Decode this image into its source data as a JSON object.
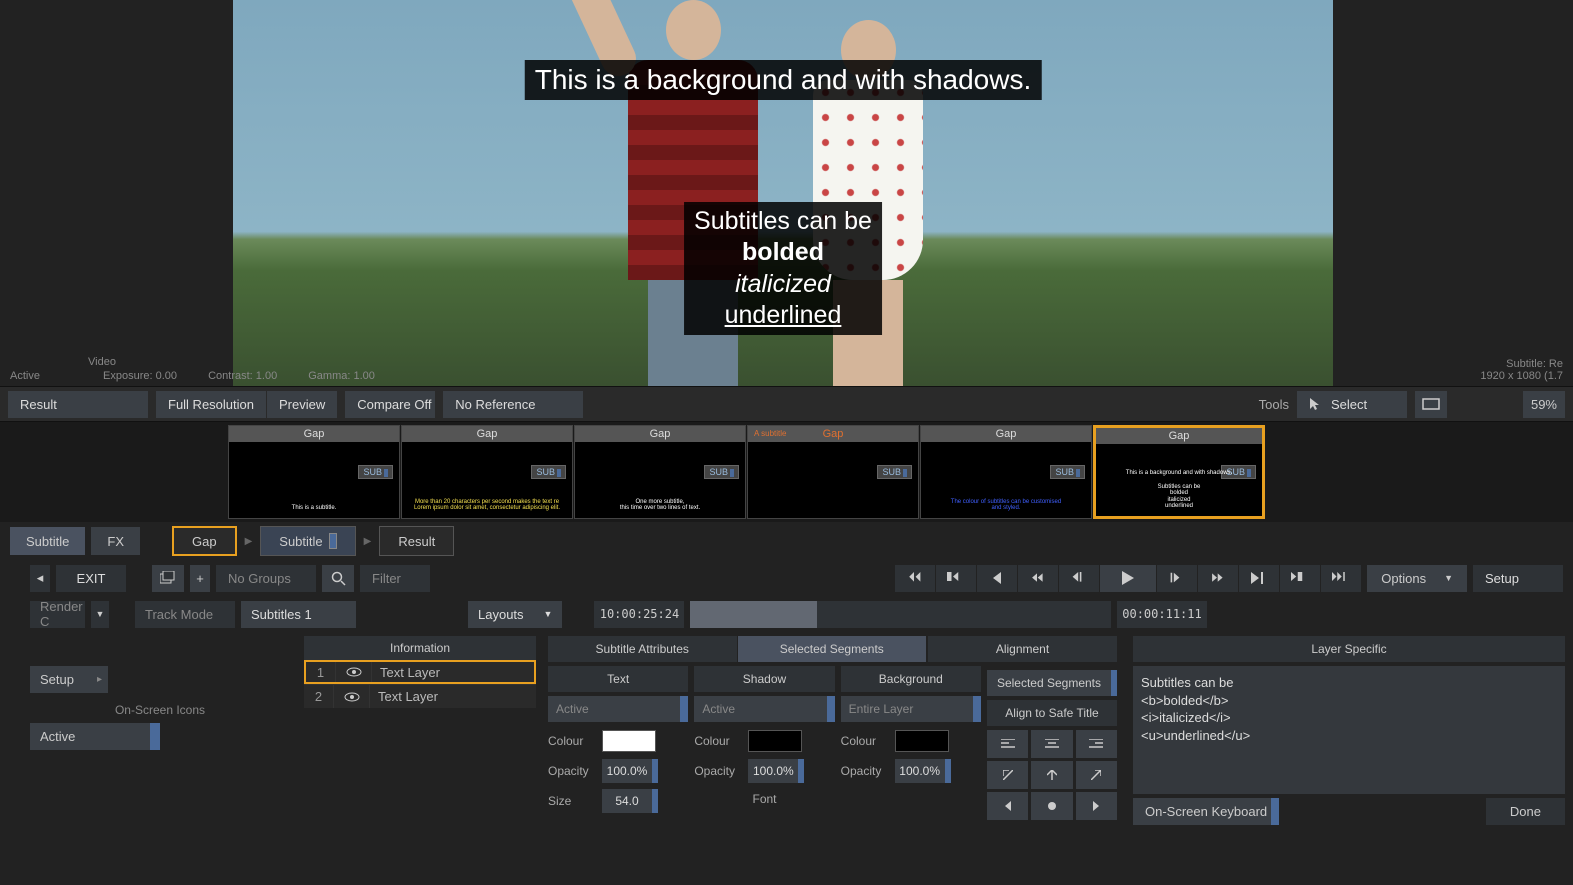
{
  "viewer": {
    "subtitle1": "This is a background and with shadows.",
    "subtitle2_line1": "Subtitles can be",
    "subtitle2_bold": "bolded",
    "subtitle2_italic": "italicized",
    "subtitle2_underline": "underlined",
    "info_active": "Active",
    "info_video": "Video",
    "info_exposure": "Exposure: 0.00",
    "info_contrast": "Contrast: 1.00",
    "info_gamma": "Gamma: 1.00",
    "info_subtitle": "Subtitle: Re",
    "info_res": "1920 x 1080 (1.7"
  },
  "toolbar": {
    "result": "Result",
    "full_resolution": "Full Resolution",
    "preview": "Preview",
    "compare_off": "Compare Off",
    "no_reference": "No Reference",
    "tools": "Tools",
    "select": "Select",
    "zoom": "59%"
  },
  "thumbs": [
    {
      "head": "Gap",
      "badge": "SUB",
      "text": "This is a subtitle.",
      "cls": ""
    },
    {
      "head": "Gap",
      "badge": "SUB",
      "text": "More than 20 characters per second makes the text re\nLorem ipsum dolor sit amet, consectetur adipiscing elit.",
      "cls": "yellow"
    },
    {
      "head": "Gap",
      "badge": "SUB",
      "text": "One more subtitle,\nthis time over two lines of text.",
      "cls": ""
    },
    {
      "head": "Gap",
      "badge": "SUB",
      "head_extra": "A subtitle",
      "text": "",
      "cls": ""
    },
    {
      "head": "Gap",
      "badge": "SUB",
      "text": "The colour of subtitles can be customised\nand styled.",
      "cls": "blue"
    },
    {
      "head": "Gap",
      "badge": "SUB",
      "text": "This is a background and with shadows.\n\nSubtitles can be\nbolded\nitalicized\nunderlined",
      "cls": "",
      "selected": true
    }
  ],
  "tabs": {
    "subtitle": "Subtitle",
    "fx": "FX"
  },
  "crumbs": {
    "gap": "Gap",
    "subtitle": "Subtitle",
    "result": "Result"
  },
  "controls": {
    "exit": "EXIT",
    "no_groups": "No Groups",
    "filter": "Filter",
    "options": "Options",
    "setup": "Setup"
  },
  "row2": {
    "render_c": "Render C",
    "track_mode": "Track Mode",
    "subtitles_1": "Subtitles 1",
    "layouts": "Layouts",
    "tc_in": "10:00:25:24",
    "tc_dur": "00:00:11:11"
  },
  "left_panel": {
    "setup": "Setup",
    "on_screen_icons": "On-Screen Icons",
    "active": "Active"
  },
  "layers": {
    "header": "Information",
    "rows": [
      {
        "n": "1",
        "name": "Text Layer",
        "selected": true
      },
      {
        "n": "2",
        "name": "Text Layer",
        "selected": false
      }
    ]
  },
  "attrs": {
    "tab1": "Subtitle Attributes",
    "tab2": "Selected Segments",
    "col_text": "Text",
    "col_shadow": "Shadow",
    "col_background": "Background",
    "active": "Active",
    "entire_layer": "Entire Layer",
    "colour": "Colour",
    "opacity": "Opacity",
    "size": "Size",
    "opacity_val": "100.0%",
    "size_val": "54.0",
    "font": "Font"
  },
  "align": {
    "header": "Alignment",
    "selected_segments": "Selected Segments",
    "align_safe": "Align to Safe Title"
  },
  "text_panel": {
    "header": "Layer Specific",
    "line1": "Subtitles can be",
    "line2": "<b>bolded</b>",
    "line3": "<i>italicized</i>",
    "line4": "<u>underlined</u>",
    "osk": "On-Screen Keyboard",
    "done": "Done"
  }
}
